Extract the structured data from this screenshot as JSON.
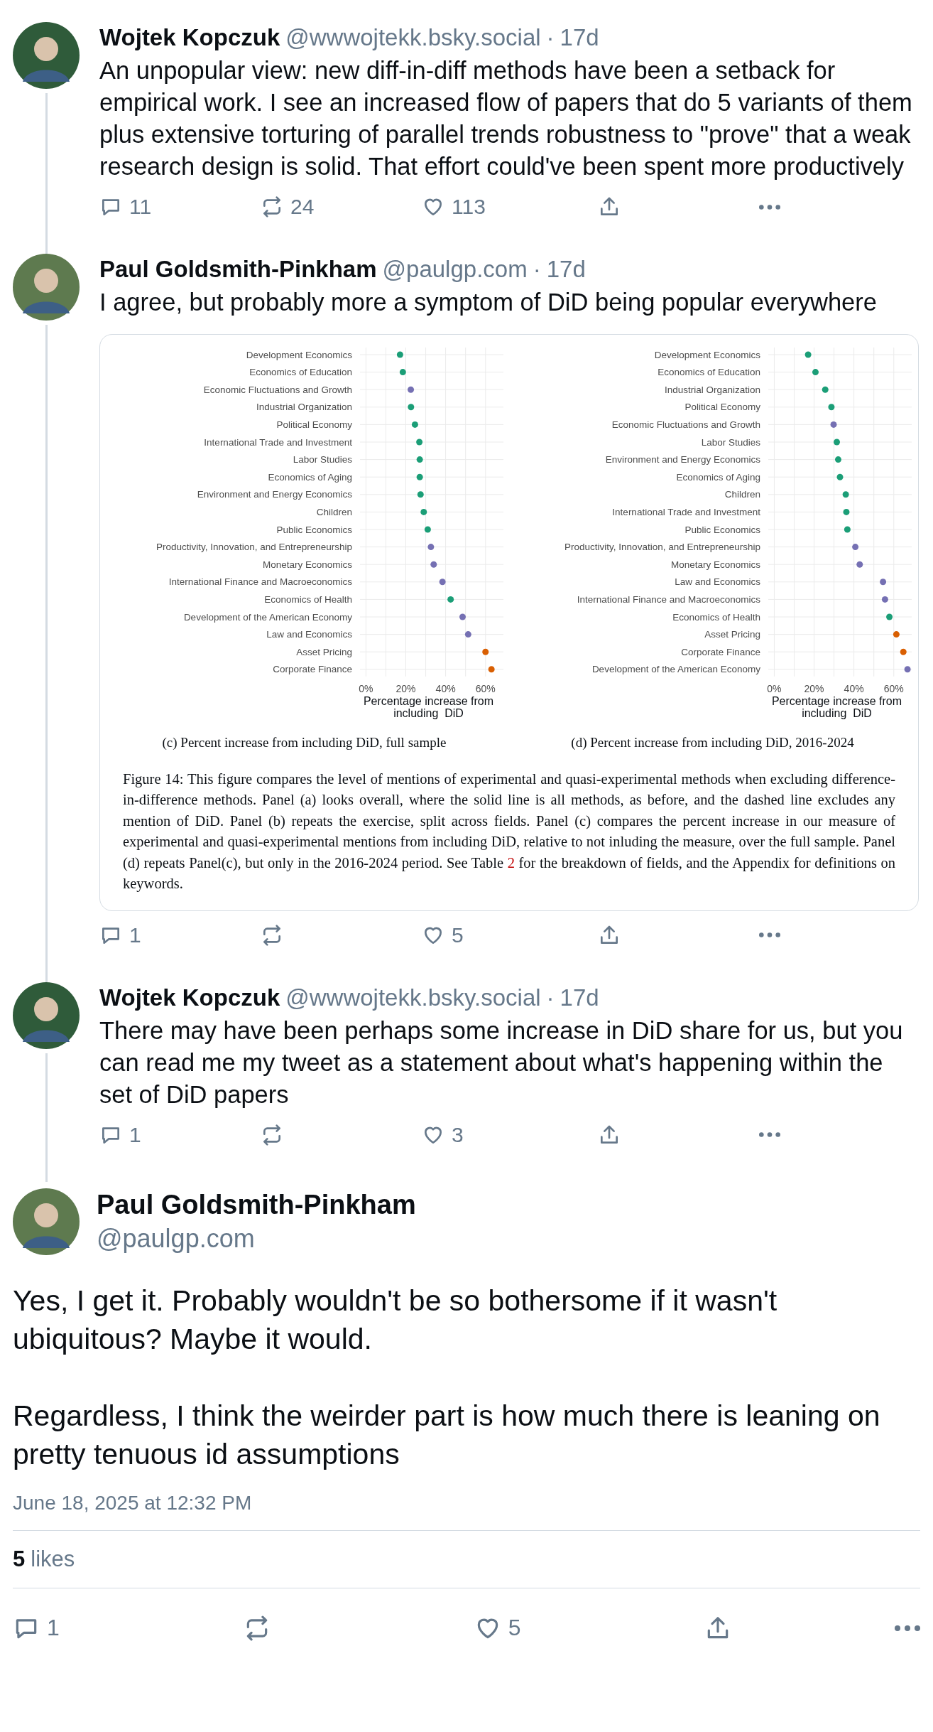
{
  "thread": [
    {
      "author": "Wojtek Kopczuk",
      "handle": "@wwwojtekk.bsky.social",
      "separator": "·",
      "time": "17d",
      "text": "An unpopular view: new diff-in-diff methods have been a setback for empirical work. I see an increased flow of papers that do 5 variants of them plus extensive torturing of parallel trends robustness to \"prove\" that a weak research design is solid. That effort could've been spent more productively",
      "reply_count": "11",
      "repost_count": "24",
      "like_count": "113"
    },
    {
      "author": "Paul Goldsmith-Pinkham",
      "handle": "@paulgp.com",
      "separator": "·",
      "time": "17d",
      "text": "I agree, but probably more a symptom of DiD being popular everywhere",
      "figure": {
        "panels": [
          {
            "caption": "(c) Percent increase from including DiD, full sample",
            "chart_data": {
              "type": "scatter",
              "orientation": "horizontal",
              "grid": true,
              "xlabel": "Percentage increase from including  DiD",
              "xlim": [
                -3,
                69
              ],
              "xticks": [
                {
                  "value": 0,
                  "label": "0%"
                },
                {
                  "value": 20,
                  "label": "20%"
                },
                {
                  "value": 40,
                  "label": "40%"
                },
                {
                  "value": 60,
                  "label": "60%"
                }
              ],
              "categories": [
                "Development Economics",
                "Economics of Education",
                "Economic Fluctuations and Growth",
                "Industrial Organization",
                "Political Economy",
                "International Trade and Investment",
                "Labor Studies",
                "Economics of Aging",
                "Environment and Energy Economics",
                "Children",
                "Public Economics",
                "Productivity, Innovation, and Entrepreneurship",
                "Monetary Economics",
                "International Finance and Macroeconomics",
                "Economics of Health",
                "Development of the American Economy",
                "Law and Economics",
                "Asset Pricing",
                "Corporate Finance"
              ],
              "series": [
                {
                  "color": "#1b9e77",
                  "values": [
                    17.1,
                    18.5,
                    null,
                    22.6,
                    24.6,
                    26.8,
                    27,
                    27,
                    27.4,
                    29,
                    31,
                    null,
                    null,
                    null,
                    42.5,
                    null,
                    null,
                    null,
                    null
                  ]
                },
                {
                  "color": "#7570b3",
                  "values": [
                    null,
                    null,
                    22.5,
                    null,
                    null,
                    null,
                    null,
                    null,
                    null,
                    null,
                    null,
                    32.6,
                    34,
                    38.4,
                    null,
                    48.5,
                    51.3,
                    null,
                    null
                  ]
                },
                {
                  "color": "#d95f02",
                  "values": [
                    null,
                    null,
                    null,
                    null,
                    null,
                    null,
                    null,
                    null,
                    null,
                    null,
                    null,
                    null,
                    null,
                    null,
                    null,
                    null,
                    null,
                    60,
                    63
                  ]
                }
              ]
            }
          },
          {
            "caption": "(d) Percent increase from including DiD, 2016-2024",
            "chart_data": {
              "type": "scatter",
              "orientation": "horizontal",
              "grid": true,
              "xlabel": "Percentage increase from including  DiD",
              "xlim": [
                -3,
                69
              ],
              "xticks": [
                {
                  "value": 0,
                  "label": "0%"
                },
                {
                  "value": 20,
                  "label": "20%"
                },
                {
                  "value": 40,
                  "label": "40%"
                },
                {
                  "value": 60,
                  "label": "60%"
                }
              ],
              "categories": [
                "Development Economics",
                "Economics of Education",
                "Industrial Organization",
                "Political Economy",
                "Economic Fluctuations and Growth",
                "Labor Studies",
                "Environment and Energy Economics",
                "Economics of Aging",
                "Children",
                "International Trade and Investment",
                "Public Economics",
                "Productivity, Innovation, and Entrepreneurship",
                "Monetary Economics",
                "Law and Economics",
                "International Finance and Macroeconomics",
                "Economics of Health",
                "Asset Pricing",
                "Corporate Finance",
                "Development of the American Economy"
              ],
              "series": [
                {
                  "color": "#1b9e77",
                  "values": [
                    17,
                    20.7,
                    25.6,
                    28.7,
                    null,
                    31.4,
                    32.1,
                    33,
                    35.9,
                    36.2,
                    36.7,
                    null,
                    null,
                    null,
                    null,
                    57.8,
                    null,
                    null,
                    null
                  ]
                },
                {
                  "color": "#7570b3",
                  "values": [
                    null,
                    null,
                    null,
                    null,
                    29.8,
                    null,
                    null,
                    null,
                    null,
                    null,
                    null,
                    40.7,
                    42.9,
                    54.6,
                    55.6,
                    null,
                    null,
                    null,
                    66.9
                  ]
                },
                {
                  "color": "#d95f02",
                  "values": [
                    null,
                    null,
                    null,
                    null,
                    null,
                    null,
                    null,
                    null,
                    null,
                    null,
                    null,
                    null,
                    null,
                    null,
                    null,
                    null,
                    61.3,
                    64.8,
                    null
                  ]
                }
              ]
            }
          }
        ],
        "note_before": "Figure 14: This figure compares the level of mentions of experimental and quasi-experimental methods when excluding difference-in-difference methods. Panel (a) looks overall, where the solid line is all methods, as before, and the dashed line excludes any mention of DiD. Panel (b) repeats the exercise, split across fields. Panel (c) compares the percent increase in our measure of experimental and quasi-experimental mentions from including DiD, relative to not inluding the measure, over the full sample. Panel (d) repeats Panel(c), but only in the 2016-2024 period. See Table ",
        "note_ref": "2",
        "note_after": " for the breakdown of fields, and the Appendix for definitions on keywords."
      },
      "reply_count": "1",
      "like_count": "5"
    },
    {
      "author": "Wojtek Kopczuk",
      "handle": "@wwwojtekk.bsky.social",
      "separator": "·",
      "time": "17d",
      "text": "There may have been perhaps some increase in DiD share for us, but you can read me my tweet as a statement about what's happening within the set of DiD papers",
      "reply_count": "1",
      "like_count": "3"
    }
  ],
  "main_post": {
    "author": "Paul Goldsmith-Pinkham",
    "handle": "@paulgp.com",
    "paragraphs": [
      "Yes, I get it. Probably wouldn't be so bothersome if it wasn't ubiquitous? Maybe it would.",
      "Regardless, I think the weirder part is how much there is leaning on pretty tenuous id assumptions"
    ],
    "timestamp": "June 18, 2025 at 12:32 PM",
    "likes_count": "5",
    "likes_label": "likes",
    "reply_count": "1",
    "like_count": "5"
  }
}
